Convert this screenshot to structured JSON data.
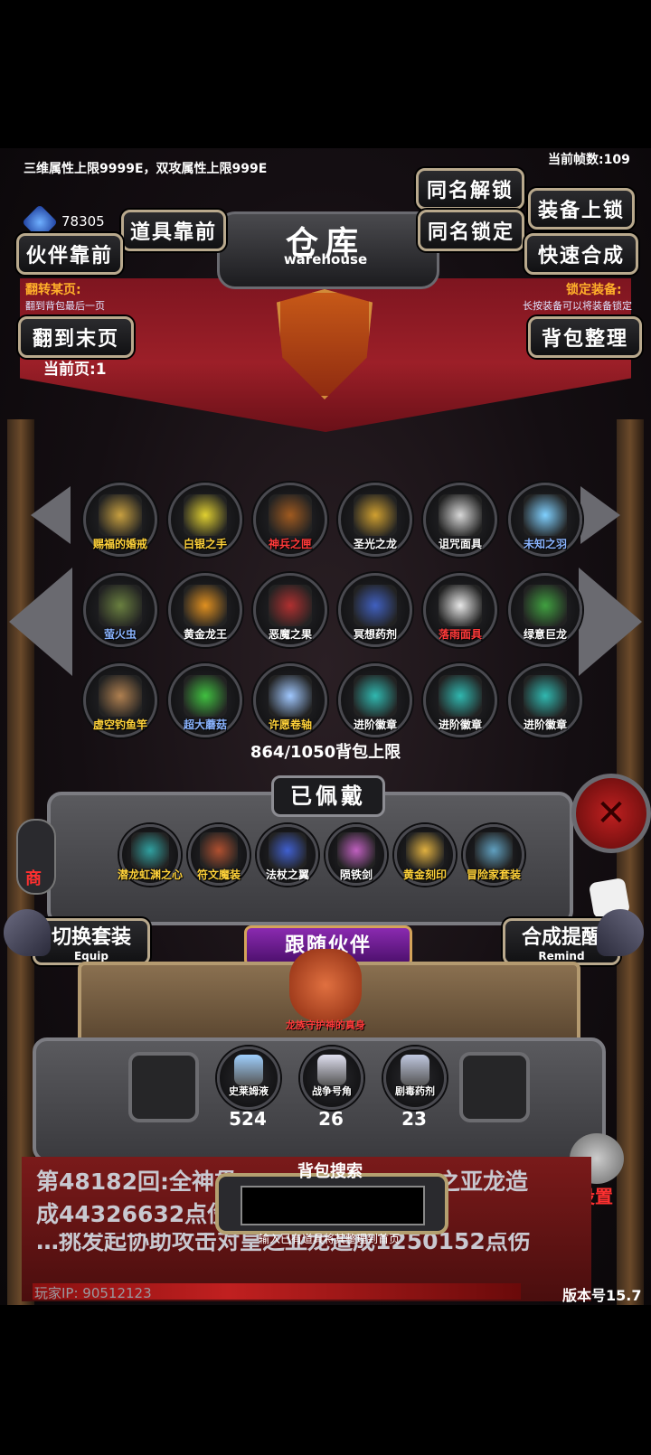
{
  "header": {
    "attr_limit_text": "三维属性上限9999E，双攻属性上限999E",
    "fps_text": "当前帧数:109",
    "gem_count": "78305"
  },
  "title": {
    "cn": "仓库",
    "en": "warehouse"
  },
  "buttons": {
    "items_front": "道具靠前",
    "partner_front": "伙伴靠前",
    "same_name_unlock": "同名解锁",
    "same_name_lock": "同名锁定",
    "equip_lock": "装备上锁",
    "quick_combine": "快速合成",
    "last_page": "翻到末页",
    "sort_bag": "背包整理",
    "switch_set": "切换套装",
    "switch_set_sub": "Equip",
    "combine_remind": "合成提醒",
    "combine_remind_sub": "Remind",
    "settings": "设置",
    "shop": "商"
  },
  "page_jump": {
    "title": "翻转某页:",
    "desc": "翻到背包最后一页"
  },
  "lock_equip": {
    "title": "锁定装备:",
    "desc": "长按装备可以将装备锁定"
  },
  "current_page": "当前页:1",
  "inventory": {
    "items": [
      {
        "name": "赐福的婚戒",
        "color": "#ffd23a",
        "icon": "ring-icon",
        "tint": "#c8a040"
      },
      {
        "name": "白银之手",
        "color": "#ffd23a",
        "icon": "hand-icon",
        "tint": "#e0d030"
      },
      {
        "name": "神兵之匣",
        "color": "#ff3a3a",
        "icon": "chest-icon",
        "tint": "#a05a20"
      },
      {
        "name": "圣光之龙",
        "color": "#ffffff",
        "icon": "dragon-icon",
        "tint": "#d0a030"
      },
      {
        "name": "诅咒面具",
        "color": "#ffffff",
        "icon": "mask-icon",
        "tint": "#d8d8d8"
      },
      {
        "name": "未知之羽",
        "color": "#8ab4ff",
        "icon": "feather-icon",
        "tint": "#7fd0ff"
      },
      {
        "name": "萤火虫",
        "color": "#8ab4ff",
        "icon": "firefly-icon",
        "tint": "#6a8040"
      },
      {
        "name": "黄金龙王",
        "color": "#ffffff",
        "icon": "gold-dragon-icon",
        "tint": "#e09020"
      },
      {
        "name": "恶魔之果",
        "color": "#ffffff",
        "icon": "fruit-icon",
        "tint": "#b03030"
      },
      {
        "name": "冥想药剂",
        "color": "#ffffff",
        "icon": "potion-icon",
        "tint": "#4060c0"
      },
      {
        "name": "落雨面具",
        "color": "#ff3a3a",
        "icon": "white-mask-icon",
        "tint": "#e8e8e8"
      },
      {
        "name": "绿意巨龙",
        "color": "#ffffff",
        "icon": "green-dragon-icon",
        "tint": "#40a040"
      },
      {
        "name": "虚空钓鱼竿",
        "color": "#ffd23a",
        "icon": "fishing-rod-icon",
        "tint": "#b08050"
      },
      {
        "name": "超大蘑菇",
        "color": "#8ab4ff",
        "icon": "mushroom-icon",
        "tint": "#40c040"
      },
      {
        "name": "许愿卷轴",
        "color": "#ffd23a",
        "icon": "scroll-icon",
        "tint": "#a0c8ff"
      },
      {
        "name": "进阶徽章",
        "color": "#ffffff",
        "icon": "star-badge-icon",
        "tint": "#30b8b0"
      },
      {
        "name": "进阶徽章",
        "color": "#ffffff",
        "icon": "star-badge-icon",
        "tint": "#30b8b0"
      },
      {
        "name": "进阶徽章",
        "color": "#ffffff",
        "icon": "star-badge-icon",
        "tint": "#30b8b0"
      }
    ],
    "capacity_text": "864/1050背包上限"
  },
  "equipped": {
    "title": "已佩戴",
    "items": [
      {
        "name": "潜龙虹渊之心",
        "color": "#ffd23a",
        "icon": "crystal-icon",
        "tint": "#30a0a0"
      },
      {
        "name": "符文魔装",
        "color": "#ffd23a",
        "icon": "armor-icon",
        "tint": "#b05030"
      },
      {
        "name": "法杖之翼",
        "color": "#ffffff",
        "icon": "staff-icon",
        "tint": "#4060d0"
      },
      {
        "name": "陨铁剑",
        "color": "#ffffff",
        "icon": "sword-icon",
        "tint": "#c060c0"
      },
      {
        "name": "黄金刻印",
        "color": "#ffd23a",
        "icon": "clock-icon",
        "tint": "#e0b040"
      },
      {
        "name": "冒险家套装",
        "color": "#ffd23a",
        "icon": "adventurer-icon",
        "tint": "#60a0c0"
      }
    ]
  },
  "partner": {
    "title": "跟随伙伴",
    "name": "龙族守护神的真身"
  },
  "consumables": [
    {
      "name": "史莱姆液",
      "count": "524",
      "icon": "slime-bottle-icon",
      "tint": "#9fd0ff"
    },
    {
      "name": "战争号角",
      "count": "26",
      "icon": "horn-icon",
      "tint": "#e0e0f0"
    },
    {
      "name": "剧毒药剂",
      "count": "23",
      "icon": "poison-bottle-icon",
      "tint": "#c0c8e0"
    }
  ],
  "log": {
    "line1": "第48182回:全神贯",
    "line1b": "之亚龙造",
    "line2": "成44326632点伤害",
    "line3": "…挑发起协助攻击对皇之亚龙造成1250152点伤"
  },
  "search": {
    "title": "背包搜索",
    "hint": "输入已有道具将其整理到首页",
    "value": ""
  },
  "footer": {
    "player_ip": "玩家IP: 90512123",
    "version": "版本号15.7"
  }
}
